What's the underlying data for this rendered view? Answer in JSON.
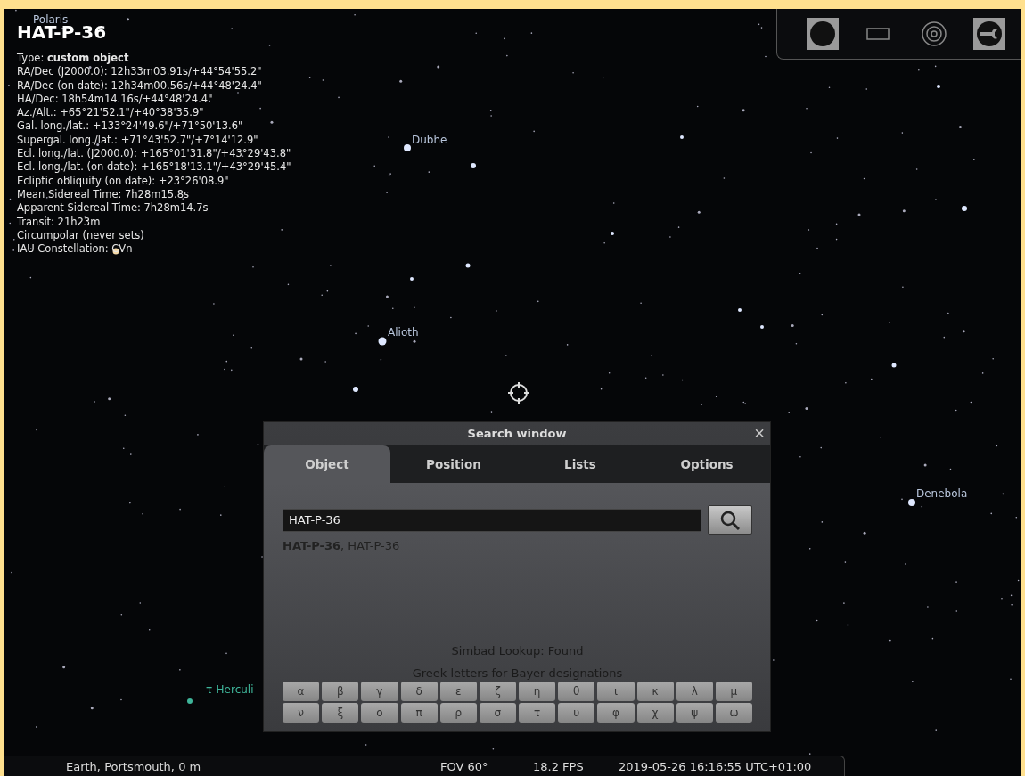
{
  "object_info": {
    "title": "HAT-P-36",
    "lines": [
      "Type: **custom object**",
      "RA/Dec (J2000.0): 12h33m03.91s/+44°54'55.2\"",
      "RA/Dec (on date): 12h34m00.56s/+44°48'24.4\"",
      "HA/Dec: 18h54m14.16s/+44°48'24.4\"",
      "Az./Alt.: +65°21'52.1\"/+40°38'35.9\"",
      "Gal. long./lat.: +133°24'49.6\"/+71°50'13.6\"",
      "Supergal. long./lat.: +71°43'52.7\"/+7°14'12.9\"",
      "Ecl. long./lat. (J2000.0): +165°01'31.8\"/+43°29'43.8\"",
      "Ecl. long./lat. (on date): +165°18'13.1\"/+43°29'45.4\"",
      "Ecliptic obliquity (on date): +23°26'08.9\"",
      "Mean Sidereal Time: 7h28m15.8s",
      "Apparent Sidereal Time: 7h28m14.7s",
      "Transit: 21h23m",
      "Circumpolar (never sets)",
      "IAU Constellation: CVn"
    ]
  },
  "star_labels": [
    "Polaris",
    "Dubhe",
    "Alioth",
    "Denebola",
    "τ-Herculi"
  ],
  "toolbar": [
    {
      "kind": "disc",
      "selected": true
    },
    {
      "kind": "frame",
      "selected": false
    },
    {
      "kind": "rings",
      "selected": false
    },
    {
      "kind": "wrench",
      "selected": true
    }
  ],
  "search_window": {
    "title": "Search window",
    "close": "×",
    "tabs": [
      {
        "label": "Object",
        "selected": true
      },
      {
        "label": "Position",
        "selected": false
      },
      {
        "label": "Lists",
        "selected": false
      },
      {
        "label": "Options",
        "selected": false
      }
    ],
    "query": "HAT-P-36",
    "result": "**HAT-P-36**, HAT-P-36",
    "status": "Simbad Lookup: Found",
    "greek_heading": "Greek letters for Bayer designations",
    "greek_rows": [
      [
        "α",
        "β",
        "γ",
        "δ",
        "ε",
        "ζ",
        "η",
        "θ",
        "ι",
        "κ",
        "λ",
        "μ"
      ],
      [
        "ν",
        "ξ",
        "ο",
        "π",
        "ρ",
        "σ",
        "τ",
        "υ",
        "φ",
        "χ",
        "ψ",
        "ω"
      ]
    ]
  },
  "status_bar": {
    "location": "Earth, Portsmouth, 0 m",
    "fov": "FOV 60°",
    "fps": "18.2 FPS",
    "datetime": "2019-05-26 16:16:55 UTC+01:00"
  }
}
